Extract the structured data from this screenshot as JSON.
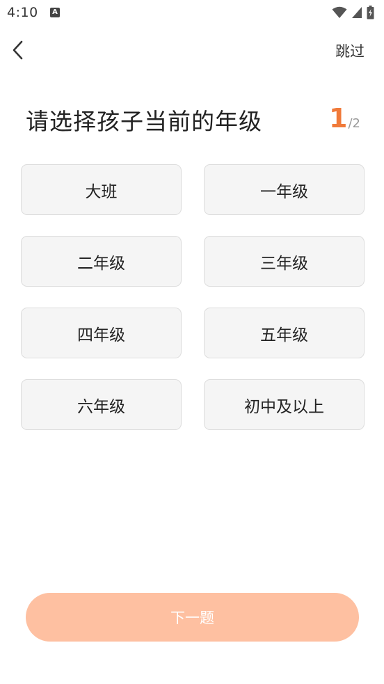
{
  "status_bar": {
    "time": "4:10",
    "notification_icon": "a-icon",
    "wifi_icon": "wifi-icon",
    "signal_icon": "signal-icon",
    "battery_icon": "battery-charging-icon"
  },
  "header": {
    "back_icon": "chevron-left-icon",
    "skip_label": "跳过"
  },
  "question": {
    "title": "请选择孩子当前的年级",
    "progress_current": "1",
    "progress_total": "/2"
  },
  "grades": [
    {
      "label": "大班"
    },
    {
      "label": "一年级"
    },
    {
      "label": "二年级"
    },
    {
      "label": "三年级"
    },
    {
      "label": "四年级"
    },
    {
      "label": "五年级"
    },
    {
      "label": "六年级"
    },
    {
      "label": "初中及以上"
    }
  ],
  "footer": {
    "next_label": "下一题"
  },
  "colors": {
    "accent": "#f07a3a",
    "next_button_disabled": "#fec0a1",
    "option_background": "#f5f5f5"
  }
}
